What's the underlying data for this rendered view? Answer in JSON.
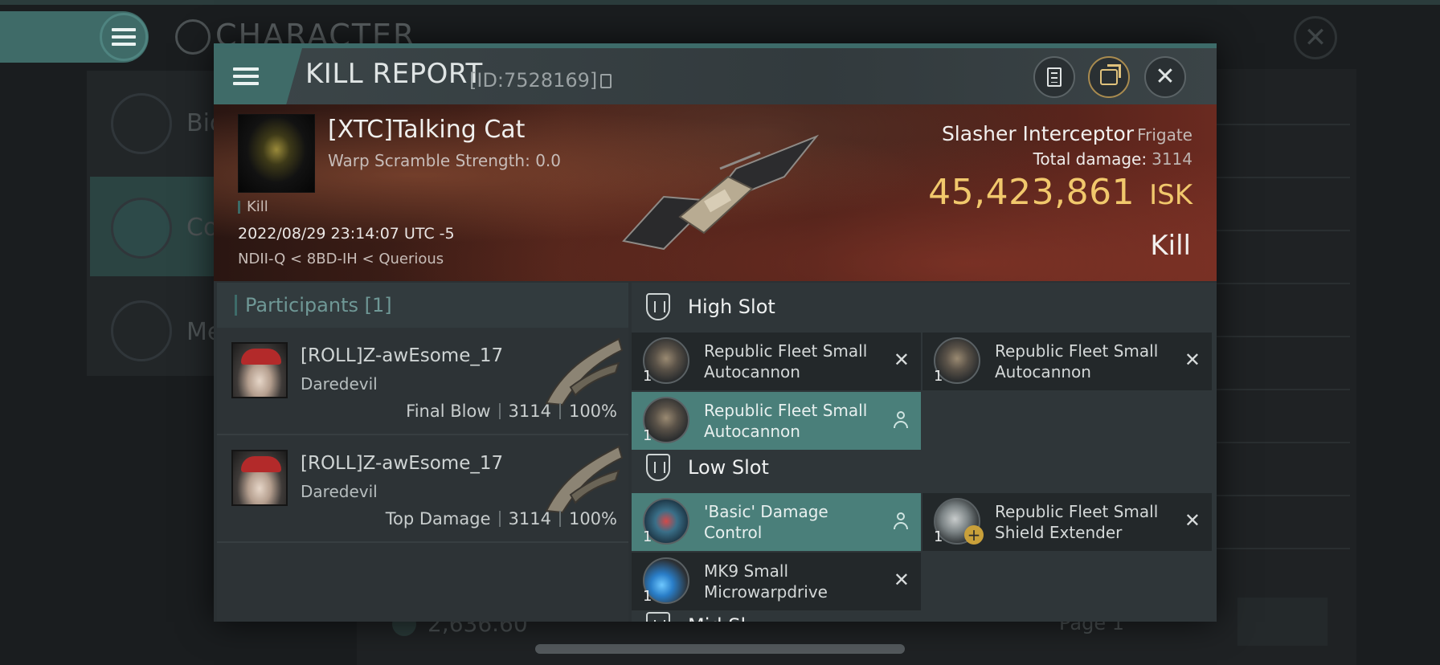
{
  "background": {
    "title": "CHARACTER",
    "side_items": [
      "Bio",
      "Co",
      "Me"
    ],
    "bottom_value": "2,636.60",
    "page_label": "Page 1"
  },
  "header": {
    "title": "KILL REPORT",
    "id_text": "[ID:7528169]",
    "menu_icon": "hamburger-icon",
    "buttons": [
      "document-icon",
      "export-icon",
      "close-icon"
    ]
  },
  "victim": {
    "name": "[XTC]Talking Cat",
    "warp_scramble": "Warp Scramble Strength: 0.0",
    "tag": "Kill",
    "date": "2022/08/29 23:14:07 UTC -5",
    "location": "NDII-Q < 8BD-IH < Querious",
    "ship_name": "Slasher Interceptor",
    "ship_class": "Frigate",
    "total_damage_label": "Total damage:",
    "total_damage_value": "3114",
    "isk_value": "45,423,861",
    "isk_unit": "ISK",
    "outcome": "Kill"
  },
  "participants": {
    "label": "Participants",
    "count": "[1]",
    "rows": [
      {
        "name": "[ROLL]Z-awEsome_17",
        "ship": "Daredevil",
        "role": "Final Blow",
        "damage": "3114",
        "percent": "100%"
      },
      {
        "name": "[ROLL]Z-awEsome_17",
        "ship": "Daredevil",
        "role": "Top Damage",
        "damage": "3114",
        "percent": "100%"
      }
    ]
  },
  "fitting": {
    "high_slot_label": "High Slot",
    "low_slot_label": "Low Slot",
    "mid_slot_partial": "Mid Sl",
    "high": [
      {
        "name": "Republic Fleet Small Autocannon",
        "qty": "1",
        "status": "destroyed"
      },
      {
        "name": "Republic Fleet Small Autocannon",
        "qty": "1",
        "status": "destroyed"
      },
      {
        "name": "Republic Fleet Small Autocannon",
        "qty": "1",
        "status": "dropped"
      }
    ],
    "low": [
      {
        "name": "'Basic' Damage Control",
        "qty": "1",
        "status": "dropped"
      },
      {
        "name": "Republic Fleet Small Shield Extender",
        "qty": "1",
        "status": "destroyed"
      },
      {
        "name": "MK9 Small Microwarpdrive",
        "qty": "1",
        "status": "destroyed"
      }
    ]
  },
  "colors": {
    "accent_teal": "#3f6b68",
    "isk_gold": "#f1c86c",
    "dropped_bg": "#4a7f7a"
  }
}
